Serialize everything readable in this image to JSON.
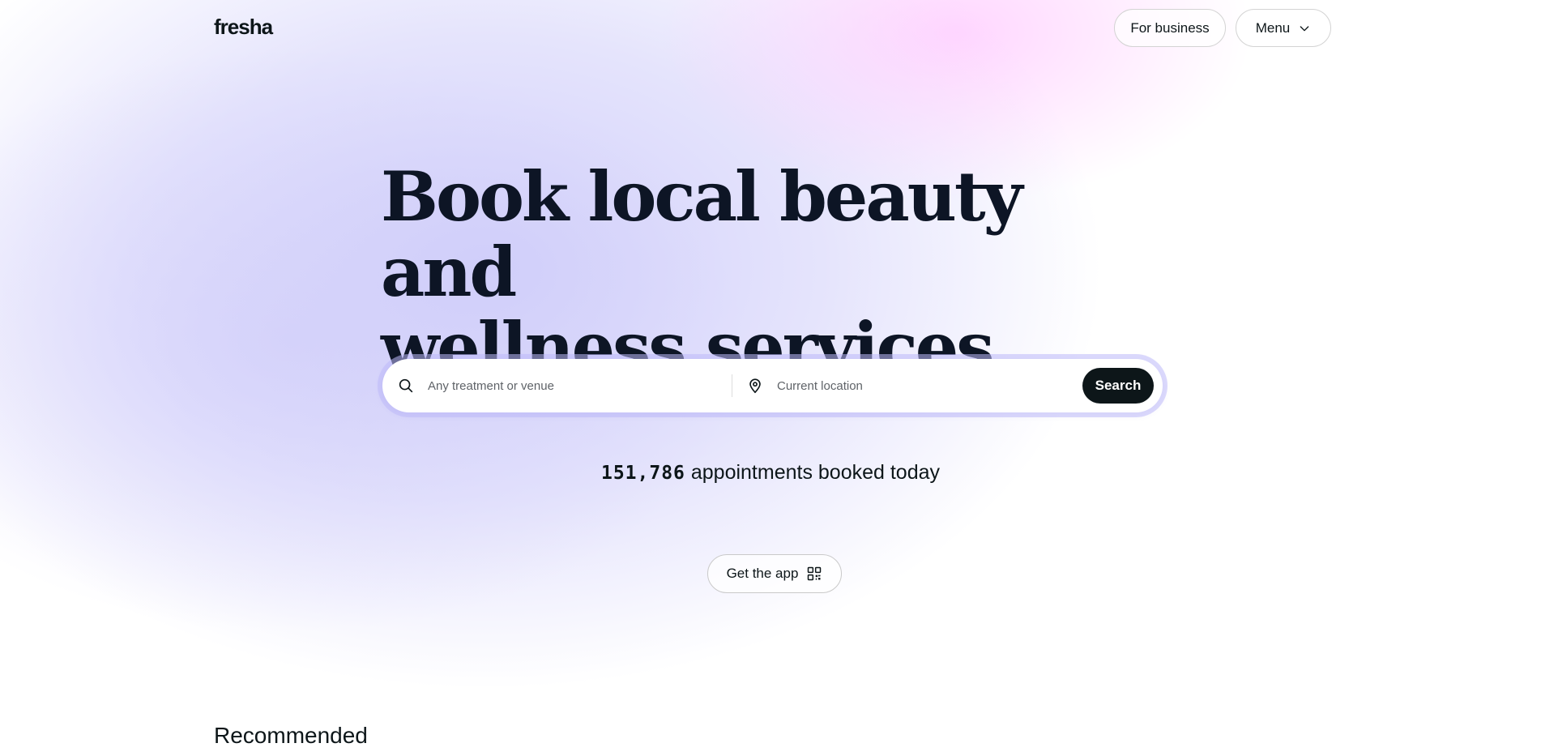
{
  "header": {
    "logo_text": "fresha",
    "for_business_label": "For business",
    "menu_label": "Menu"
  },
  "hero": {
    "headline_line1": "Book local beauty and",
    "headline_line2": "wellness services"
  },
  "search": {
    "treatment_placeholder": "Any treatment or venue",
    "location_placeholder": "Current location",
    "search_label": "Search"
  },
  "stats": {
    "count": "151,786",
    "label": " appointments booked today"
  },
  "get_app": {
    "label": "Get the app"
  },
  "recommended": {
    "title": "Recommended"
  },
  "icons": {
    "search": "search-icon",
    "location": "location-pin-icon",
    "menu_chevron": "chevron-down-icon",
    "qr": "qr-code-icon"
  },
  "colors": {
    "text_dark": "#0d1619",
    "headline": "#0d1525",
    "search_button_bg": "#0d1619",
    "gradient_lavender": "#d0cefa",
    "gradient_pink": "#ffc8ff"
  }
}
